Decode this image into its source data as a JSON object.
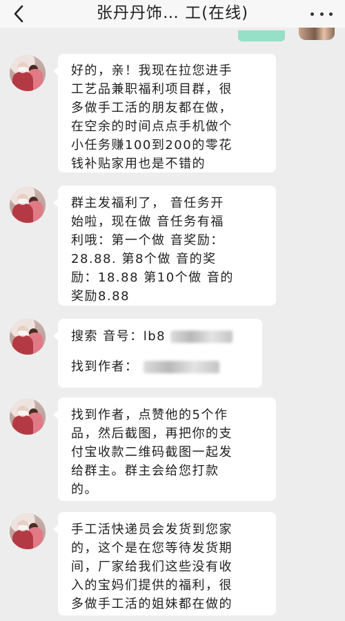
{
  "header": {
    "title": "张丹丹饰… 工(在线)"
  },
  "messages": [
    {
      "text": "好的，亲！我现在拉您进手\n工艺品兼职福利项目群，很\n多做手工活的朋友都在做，\n在空余的时间点点手机做个\n小任务赚100到200的零花\n钱补贴家用也是不错的"
    },
    {
      "text": "群主发福利了，  音任务开\n始啦，现在做  音任务有福\n利哦：第一个做  音奖励：\n28.88. 第8个做  音的奖\n励：18.88 第10个做  音的\n奖励8.88"
    },
    {
      "line1": "搜索  音号：",
      "line1_visible_id": "lb8",
      "line2": "找到作者："
    },
    {
      "text": "找到作者，点赞他的5个作\n品，然后截图，再把你的支\n付宝收款二维码截图一起发\n给群主。群主会给您打款\n的。"
    },
    {
      "text": "手工活快递员会发货到您家\n的，这个是在您等待发货期\n间，厂家给我们这些没有收\n入的宝妈们提供的福利，很\n多做手工活的姐妹都在做的"
    }
  ],
  "colors": {
    "background": "#ededed",
    "incoming_bubble": "#ffffff",
    "outgoing_bubble": "#96e0c8"
  },
  "icons": [
    "back-arrow-icon",
    "more-dots-icon"
  ]
}
